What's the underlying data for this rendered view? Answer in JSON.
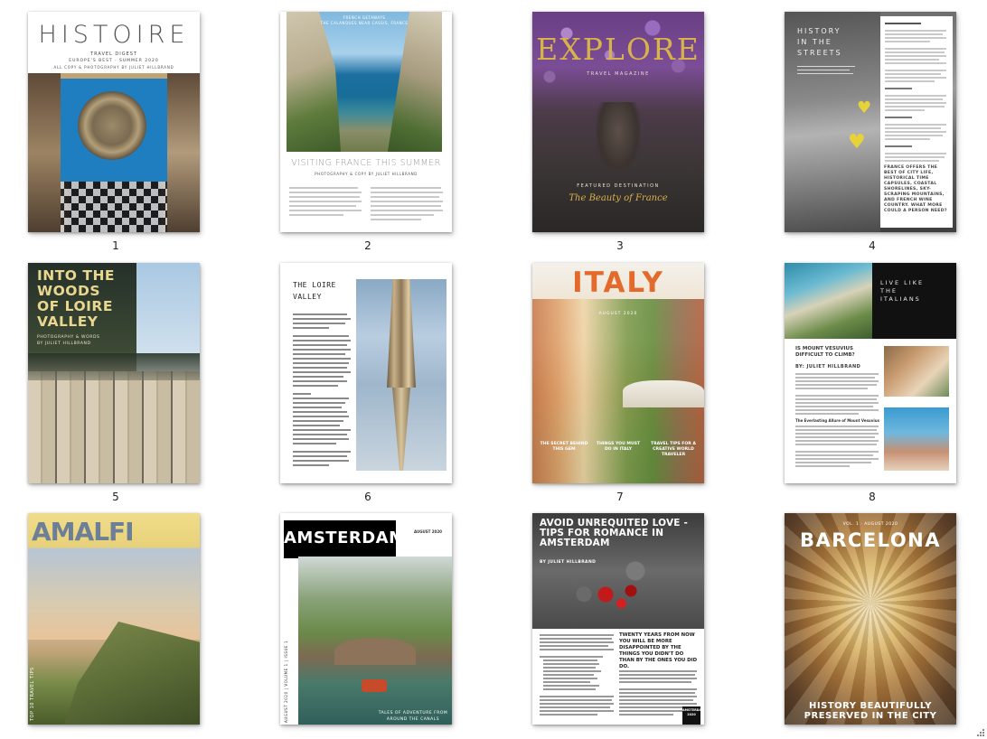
{
  "pages": [
    {
      "number": "1",
      "title": "HISTOIRE",
      "subtitle": "TRAVEL DIGEST",
      "line1": "EUROPE'S BEST · SUMMER 2020",
      "line2": "ALL COPY & PHOTOGRAPHY BY JULIET HILLBRAND"
    },
    {
      "number": "2",
      "kicker": "FRENCH GETAWAYS",
      "kicker2": "THE CALANQUES NEAR CASSIS, FRANCE",
      "title": "VISITING FRANCE THIS SUMMER",
      "byline": "PHOTOGRAPHY & COPY BY JULIET HILLBRAND"
    },
    {
      "number": "3",
      "title": "EXPLORE",
      "subtitle": "TRAVEL MAGAZINE",
      "featured": "FEATURED DESTINATION",
      "feature_title": "The Beauty of France"
    },
    {
      "number": "4",
      "title_lines": [
        "HISTORY",
        "IN THE",
        "STREETS"
      ],
      "heading": "FRANCE OFFERS THE BEST OF CITY LIFE, HISTORICAL TIME CAPSULES, COASTAL SHORELINES, SKY-SCRAPING MOUNTAINS, AND FRENCH WINE COUNTRY. WHAT MORE COULD A PERSON NEED?"
    },
    {
      "number": "5",
      "title_lines": [
        "INTO THE",
        "WOODS",
        "OF LOIRE",
        "VALLEY"
      ],
      "byline": "PHOTOGRAPHY & WORDS",
      "byline2": "BY JULIET HILLBRAND"
    },
    {
      "number": "6",
      "title_lines": [
        "THE LOIRE",
        "VALLEY"
      ]
    },
    {
      "number": "7",
      "title": "ITALY",
      "date": "AUGUST 2020",
      "cards": [
        "THE SECRET BEHIND THIS GEM",
        "THINGS YOU MUST DO IN ITALY",
        "TRAVEL TIPS FOR A CREATIVE WORLD TRAVELER"
      ]
    },
    {
      "number": "8",
      "title_lines": [
        "LIVE LIKE",
        "THE",
        "ITALIANS"
      ],
      "question": "IS MOUNT VESUVIUS DIFFICULT TO CLIMB?",
      "byline": "BY: JULIET HILLBRAND",
      "subhead": "The Everlasting Allure of Mount Vesuvius"
    },
    {
      "number": "9",
      "title": "AMALFI",
      "side_text": "TOP 10 TRAVEL TIPS"
    },
    {
      "number": "10",
      "title": "AMSTERDAM",
      "date": "AUGUST 2020",
      "caption_lines": [
        "TALES OF ADVENTURE FROM",
        "AROUND THE CANALS"
      ],
      "spine": "AUGUST 2020 | VOLUME 1 | ISSUE 1"
    },
    {
      "number": "11",
      "title_lines": [
        "AVOID UNREQUITED LOVE -",
        "TIPS FOR ROMANCE IN",
        "AMSTERDAM"
      ],
      "byline": "BY JULIET HILLBRAND",
      "quote": "TWENTY YEARS FROM NOW YOU WILL BE MORE DISAPPOINTED BY THE THINGS YOU DIDN'T DO THAN BY THE ONES YOU DID DO.",
      "tag": "AMSTERDAM 2020"
    },
    {
      "number": "12",
      "title": "BARCELONA",
      "date": "VOL. 1 · AUGUST 2020",
      "bottom_lines": [
        "HISTORY BEAUTIFULLY",
        "PRESERVED IN THE CITY"
      ]
    }
  ],
  "icons": {
    "corner": "resize-grip-icon"
  }
}
